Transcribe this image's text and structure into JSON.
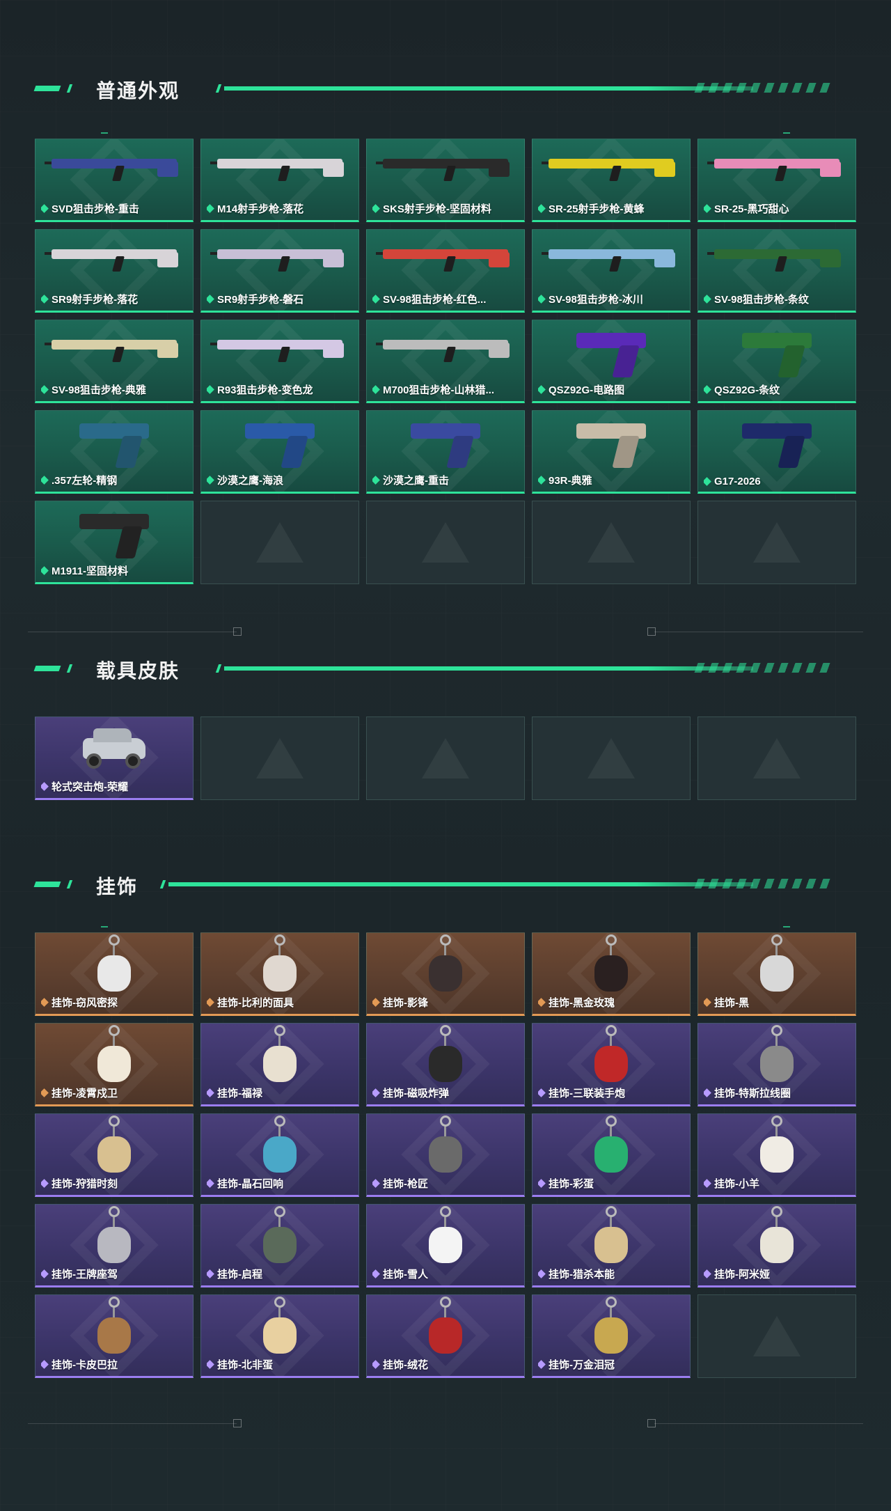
{
  "sections": [
    {
      "title": "普通外观"
    },
    {
      "title": "载具皮肤"
    },
    {
      "title": "挂饰"
    }
  ],
  "weapons": [
    {
      "label": "SVD狙击步枪-重击",
      "color": "#3a4a9a",
      "kind": "rifle"
    },
    {
      "label": "M14射手步枪-落花",
      "color": "#d8d4d8",
      "kind": "rifle"
    },
    {
      "label": "SKS射手步枪-坚固材料",
      "color": "#2a2a2a",
      "kind": "rifle"
    },
    {
      "label": "SR-25射手步枪-黄蜂",
      "color": "#e0cc20",
      "kind": "rifle"
    },
    {
      "label": "SR-25-黑巧甜心",
      "color": "#e88cb8",
      "kind": "rifle"
    },
    {
      "label": "SR9射手步枪-落花",
      "color": "#d8d4d8",
      "kind": "rifle"
    },
    {
      "label": "SR9射手步枪-磐石",
      "color": "#c8bfd6",
      "kind": "rifle"
    },
    {
      "label": "SV-98狙击步枪-红色...",
      "color": "#d4453a",
      "kind": "rifle"
    },
    {
      "label": "SV-98狙击步枪-冰川",
      "color": "#8ab8dc",
      "kind": "rifle"
    },
    {
      "label": "SV-98狙击步枪-条纹",
      "color": "#2c6a34",
      "kind": "rifle"
    },
    {
      "label": "SV-98狙击步枪-典雅",
      "color": "#d8cfa8",
      "kind": "rifle"
    },
    {
      "label": "R93狙击步枪-变色龙",
      "color": "#d4c8e4",
      "kind": "rifle"
    },
    {
      "label": "M700狙击步枪-山林猎...",
      "color": "#bcbcbc",
      "kind": "rifle"
    },
    {
      "label": "QSZ92G-电路图",
      "color": "#5a2ab8",
      "kind": "pistol"
    },
    {
      "label": "QSZ92G-条纹",
      "color": "#2c7a3a",
      "kind": "pistol"
    },
    {
      "label": ".357左轮-精钢",
      "color": "#2a6a8a",
      "kind": "pistol"
    },
    {
      "label": "沙漠之鹰-海浪",
      "color": "#2a5aa8",
      "kind": "pistol"
    },
    {
      "label": "沙漠之鹰-重击",
      "color": "#3a4aa0",
      "kind": "pistol"
    },
    {
      "label": "93R-典雅",
      "color": "#c8bca8",
      "kind": "pistol"
    },
    {
      "label": "G17-2026",
      "color": "#1e2a6a",
      "kind": "pistol"
    },
    {
      "label": "M1911-坚固材料",
      "color": "#2a2a2a",
      "kind": "pistol"
    }
  ],
  "vehicles": [
    {
      "label": "轮式突击炮-荣耀"
    }
  ],
  "charms": [
    {
      "label": "挂饰-窃风密探",
      "rarity": "orange",
      "color": "#e8e8e8"
    },
    {
      "label": "挂饰-比利的面具",
      "rarity": "orange",
      "color": "#e0d8d0"
    },
    {
      "label": "挂饰-影锋",
      "rarity": "orange",
      "color": "#3a3030"
    },
    {
      "label": "挂饰-黑金玫瑰",
      "rarity": "orange",
      "color": "#2a2020"
    },
    {
      "label": "挂饰-黑",
      "rarity": "orange",
      "color": "#d8d8d8"
    },
    {
      "label": "挂饰-凌霄戍卫",
      "rarity": "orange",
      "color": "#f0e8d8"
    },
    {
      "label": "挂饰-福禄",
      "rarity": "purple",
      "color": "#e8e0d0"
    },
    {
      "label": "挂饰-磁吸炸弹",
      "rarity": "purple",
      "color": "#2a2a2a"
    },
    {
      "label": "挂饰-三联装手炮",
      "rarity": "purple",
      "color": "#c02828"
    },
    {
      "label": "挂饰-特斯拉线圈",
      "rarity": "purple",
      "color": "#8a8a8a"
    },
    {
      "label": "挂饰-狩猎时刻",
      "rarity": "purple",
      "color": "#d8c090"
    },
    {
      "label": "挂饰-晶石回响",
      "rarity": "purple",
      "color": "#4aa8c8"
    },
    {
      "label": "挂饰-枪匠",
      "rarity": "purple",
      "color": "#6a6a6a"
    },
    {
      "label": "挂饰-彩蛋",
      "rarity": "purple",
      "color": "#28b070"
    },
    {
      "label": "挂饰-小羊",
      "rarity": "purple",
      "color": "#f0ece4"
    },
    {
      "label": "挂饰-王牌座驾",
      "rarity": "purple",
      "color": "#b8b8c0"
    },
    {
      "label": "挂饰-启程",
      "rarity": "purple",
      "color": "#5a6a5a"
    },
    {
      "label": "挂饰-雪人",
      "rarity": "purple",
      "color": "#f4f4f4"
    },
    {
      "label": "挂饰-猎杀本能",
      "rarity": "purple",
      "color": "#d8c090"
    },
    {
      "label": "挂饰-阿米娅",
      "rarity": "purple",
      "color": "#e8e4d8"
    },
    {
      "label": "挂饰-卡皮巴拉",
      "rarity": "purple",
      "color": "#a87848"
    },
    {
      "label": "挂饰-北非蛋",
      "rarity": "purple",
      "color": "#e8d0a0"
    },
    {
      "label": "挂饰-绒花",
      "rarity": "purple",
      "color": "#b82828"
    },
    {
      "label": "挂饰-万金泪冠",
      "rarity": "purple",
      "color": "#c8a850"
    }
  ],
  "colors": {
    "accent": "#2ee39a",
    "green_card": "#1d6a58",
    "purple_card": "#4a3f7a",
    "orange_card": "#6f4a34",
    "empty_card": "#253236"
  },
  "icons": [
    "diamond-rarity-icon",
    "logo-watermark-icon"
  ]
}
